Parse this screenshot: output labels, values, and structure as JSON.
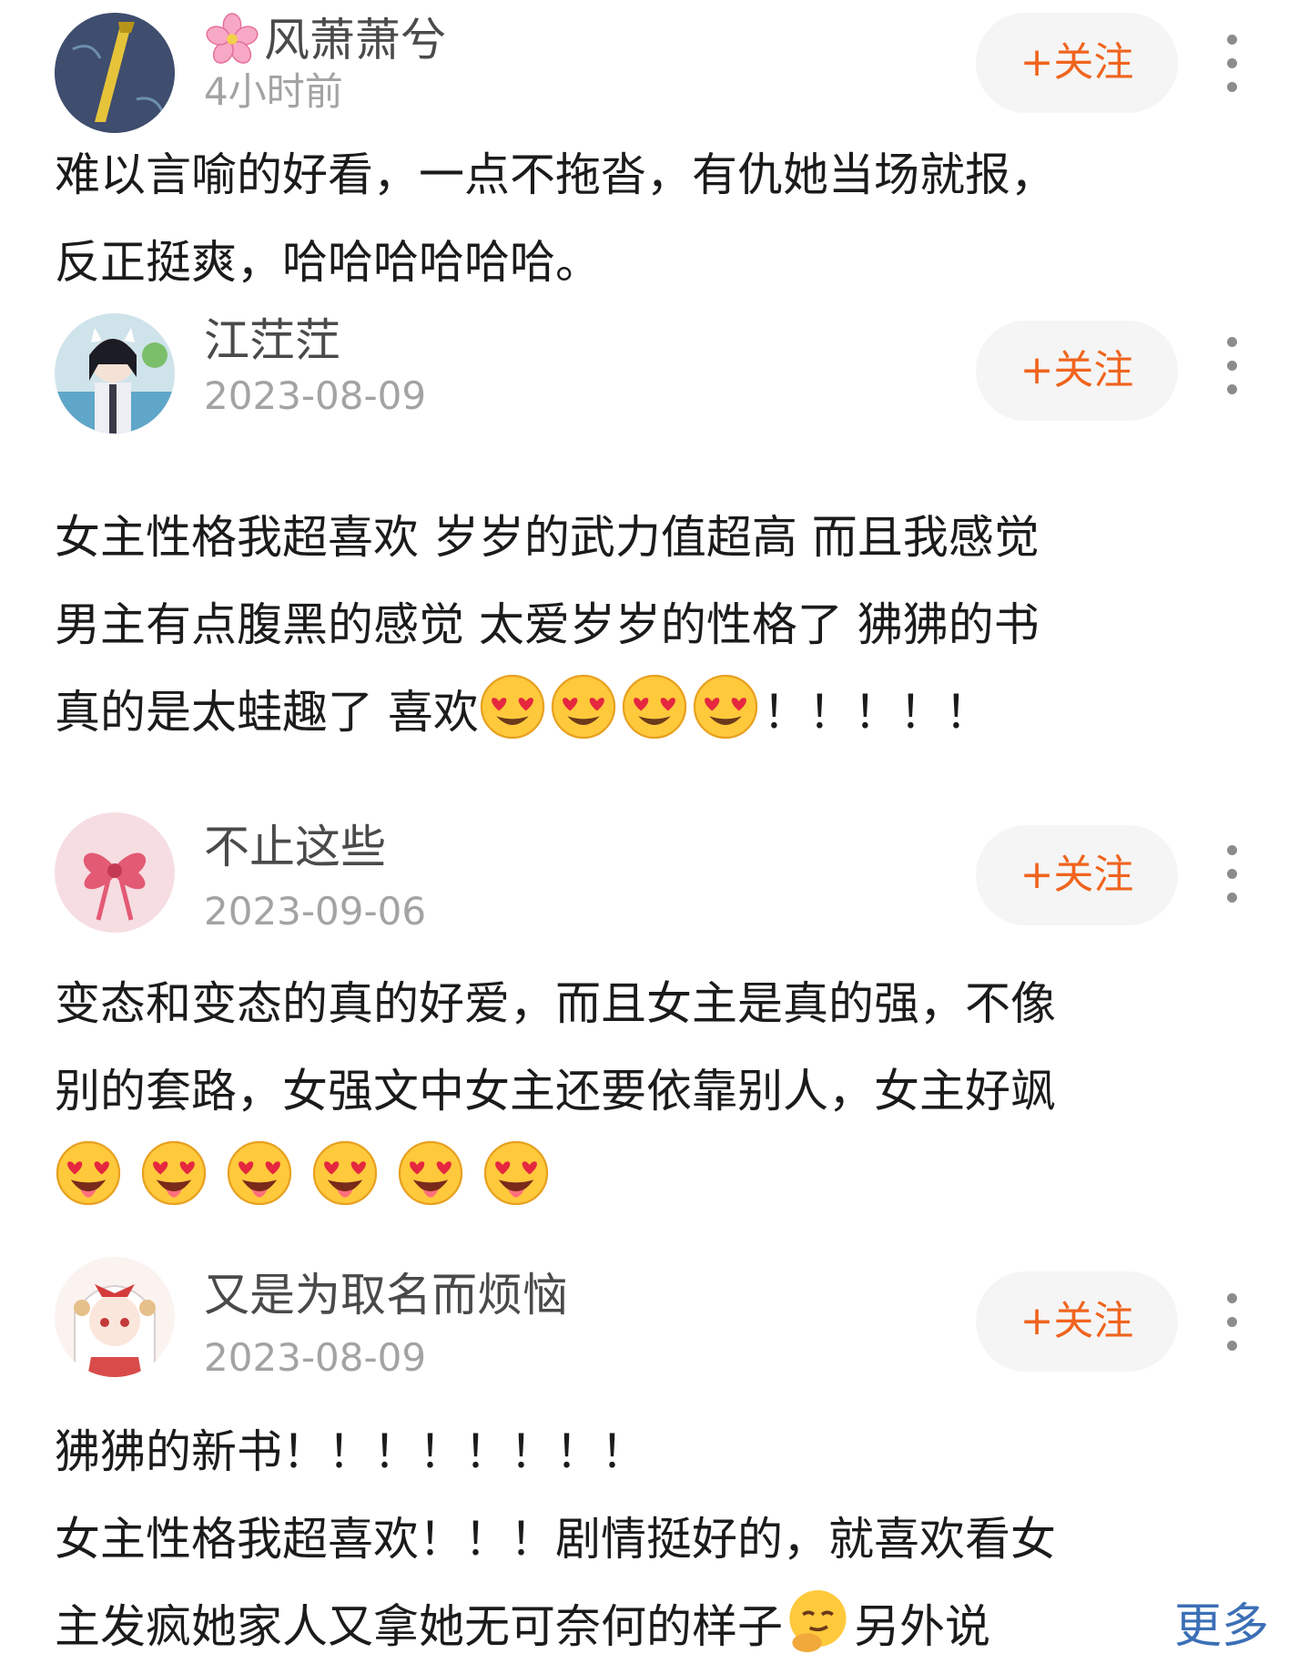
{
  "follow_label": "+关注",
  "expand_label": "更多",
  "comments": [
    {
      "username": "风萧萧兮",
      "time": "4小时前",
      "lines": [
        "难以言喻的好看，一点不拖沓，有仇她当场就报，",
        "反正挺爽，哈哈哈哈哈哈。"
      ]
    },
    {
      "username": "江茳茳",
      "time": "2023-08-09",
      "lines": [
        "女主性格我超喜欢 岁岁的武力值超高 而且我感觉",
        "男主有点腹黑的感觉 太爱岁岁的性格了 狒狒的书",
        "真的是太蛙趣了 喜欢",
        "！！！！！"
      ]
    },
    {
      "username": "不止这些",
      "time": "2023-09-06",
      "lines": [
        "变态和变态的真的好爱，而且女主是真的强，不像",
        "别的套路，女强文中女主还要依靠别人，女主好飒"
      ]
    },
    {
      "username": "又是为取名而烦恼",
      "time": "2023-08-09",
      "lines": [
        "狒狒的新书！！！！！！！！",
        "女主性格我超喜欢！！！剧情挺好的，就喜欢看女",
        "主发疯她家人又拿她无可奈何的样子",
        "另外说"
      ]
    }
  ],
  "icons": {
    "heart_eyes": "smiling-face-with-heart-eyes",
    "heart_eyes_tongue": "heart-eyes-tongue-face",
    "thinking": "smirking-hand-face",
    "flower": "cherry-blossom"
  },
  "colors": {
    "follow_text": "#f0641e",
    "follow_bg": "#f5f5f5",
    "expand_text": "#3b6fb6",
    "time_text": "#a3a3a3",
    "username_text": "#4a4a4a"
  }
}
